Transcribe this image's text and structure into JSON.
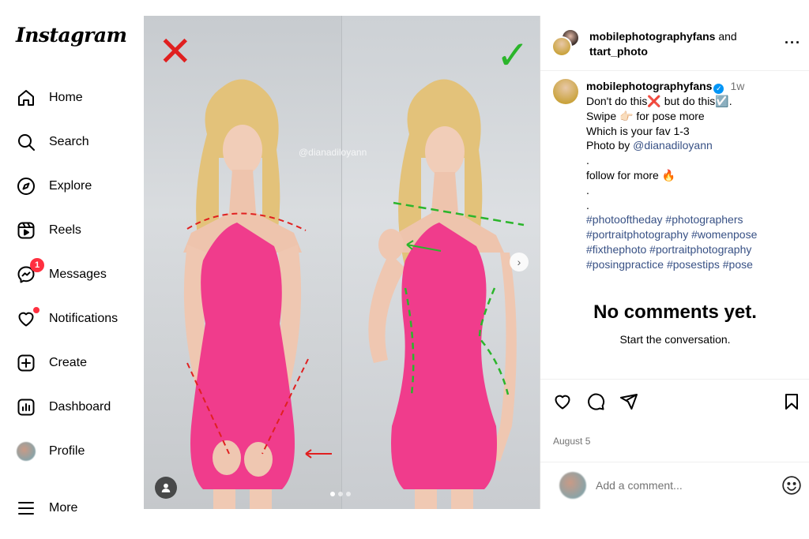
{
  "sidebar": {
    "logo": "Instagram",
    "items": [
      {
        "label": "Home",
        "icon": "home-icon"
      },
      {
        "label": "Search",
        "icon": "search-icon"
      },
      {
        "label": "Explore",
        "icon": "compass-icon"
      },
      {
        "label": "Reels",
        "icon": "reels-icon"
      },
      {
        "label": "Messages",
        "icon": "messenger-icon",
        "badge": "1"
      },
      {
        "label": "Notifications",
        "icon": "heart-icon"
      },
      {
        "label": "Create",
        "icon": "plus-square-icon"
      },
      {
        "label": "Dashboard",
        "icon": "dashboard-icon"
      },
      {
        "label": "Profile",
        "icon": "avatar"
      },
      {
        "label": "More",
        "icon": "hamburger-icon"
      }
    ]
  },
  "media": {
    "watermark": "@dianadiloyann",
    "left_mark": "✕",
    "right_mark": "✓",
    "pager_count": 3,
    "pager_active": 0
  },
  "post": {
    "header": {
      "user1": "mobilephotographyfans",
      "joiner": "and",
      "user2": "ttart_photo"
    },
    "caption": {
      "username": "mobilephotographyfans",
      "time": "1w",
      "line1": "Don't do this❌ but do this☑️.",
      "line2": "Swipe 👉🏻 for pose more",
      "line3": "Which is your fav 1-3",
      "line4_prefix": "Photo by",
      "line4_link": "@dianadiloyann",
      "dot1": ".",
      "line5": "follow  for more 🔥",
      "dot2": ".",
      "dot3": ".",
      "tags1": "#photooftheday #photographers",
      "tags2": "#portraitphotography #womenpose",
      "tags3": "#fixthephoto #portraitphotography",
      "tags4": "#posingpractice #posestips #pose"
    },
    "no_comments": "No comments yet.",
    "start_conversation": "Start the conversation.",
    "date": "August 5",
    "comment_placeholder": "Add a comment..."
  },
  "colors": {
    "accent_link": "#385185",
    "badge": "#ff3040",
    "verified": "#0095f6",
    "wrong_mark": "#e02020",
    "right_mark": "#2bb52b",
    "dress": "#f03c8c"
  }
}
